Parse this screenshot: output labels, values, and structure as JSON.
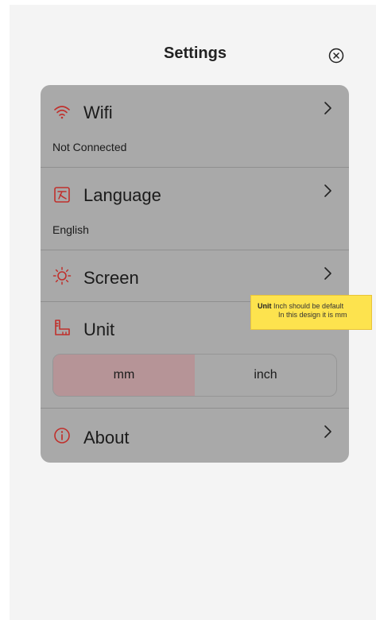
{
  "header": {
    "title": "Settings"
  },
  "icons": {
    "close": "close-circle-icon",
    "wifi": "wifi-icon",
    "language": "language-icon",
    "screen": "brightness-icon",
    "unit": "ruler-icon",
    "about": "info-icon",
    "chevron": "chevron-right-icon"
  },
  "settings": {
    "wifi": {
      "label": "Wifi",
      "status": "Not Connected"
    },
    "language": {
      "label": "Language",
      "value": "English"
    },
    "screen": {
      "label": "Screen"
    },
    "unit": {
      "label": "Unit",
      "options": [
        "mm",
        "inch"
      ],
      "selected": "mm"
    },
    "about": {
      "label": "About"
    }
  },
  "annotation": {
    "title": "Unit",
    "text_line1": "Inch should be default",
    "text_line2": "In this design it is mm"
  },
  "colors": {
    "accent": "#c0302c",
    "card_bg": "#a9a9a9",
    "selected_segment": "#b69497",
    "note_bg": "#fde34e"
  }
}
